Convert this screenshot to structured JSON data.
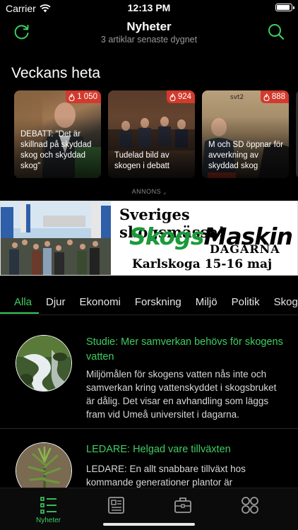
{
  "status_bar": {
    "carrier": "Carrier",
    "time": "12:13 PM",
    "battery_level": 0.95
  },
  "header": {
    "title": "Nyheter",
    "subtitle": "3 artiklar senaste dygnet",
    "left_icon": "refresh-icon",
    "right_icon": "search-icon"
  },
  "trending": {
    "title": "Veckans heta",
    "cards": [
      {
        "count": "1 050",
        "caption": "DEBATT: \"Det är skillnad på skyddad skog och skyddad skog\""
      },
      {
        "count": "924",
        "caption": "Tudelad bild av skogen i debatt"
      },
      {
        "count": "888",
        "caption": "M och SD öppnar för avverkning av skyddad skog"
      }
    ]
  },
  "ad": {
    "label": "ANNONS",
    "line1": "Sveriges skogsmässa!",
    "line2a": "Skogs",
    "line2b": "Maskin",
    "line3": "DAGARNA",
    "line4": "Karlskoga 15-16 maj"
  },
  "categories": [
    "Alla",
    "Djur",
    "Ekonomi",
    "Forskning",
    "Miljö",
    "Politik",
    "Skog"
  ],
  "articles": [
    {
      "title": "Studie: Mer samverkan behövs för skogens vatten",
      "body": "Miljömålen för skogens vatten nås inte och samverkan kring vattenskyddet i skogsbruket är dålig. Det visar en avhandling som läggs fram vid Umeå universitet i dagarna."
    },
    {
      "title": "LEDARE: Helgad vare tillväxten",
      "body": "LEDARE: En allt snabbare tillväxt hos kommande generationer plantor är"
    }
  ],
  "tabbar": {
    "items": [
      {
        "icon": "news-list-icon",
        "label": "Nyheter"
      },
      {
        "icon": "newspaper-icon",
        "label": ""
      },
      {
        "icon": "briefcase-icon",
        "label": ""
      },
      {
        "icon": "grid-icon",
        "label": ""
      }
    ]
  },
  "colors": {
    "accent": "#3ccf62",
    "badge": "#d23a2d",
    "background": "#000000"
  }
}
